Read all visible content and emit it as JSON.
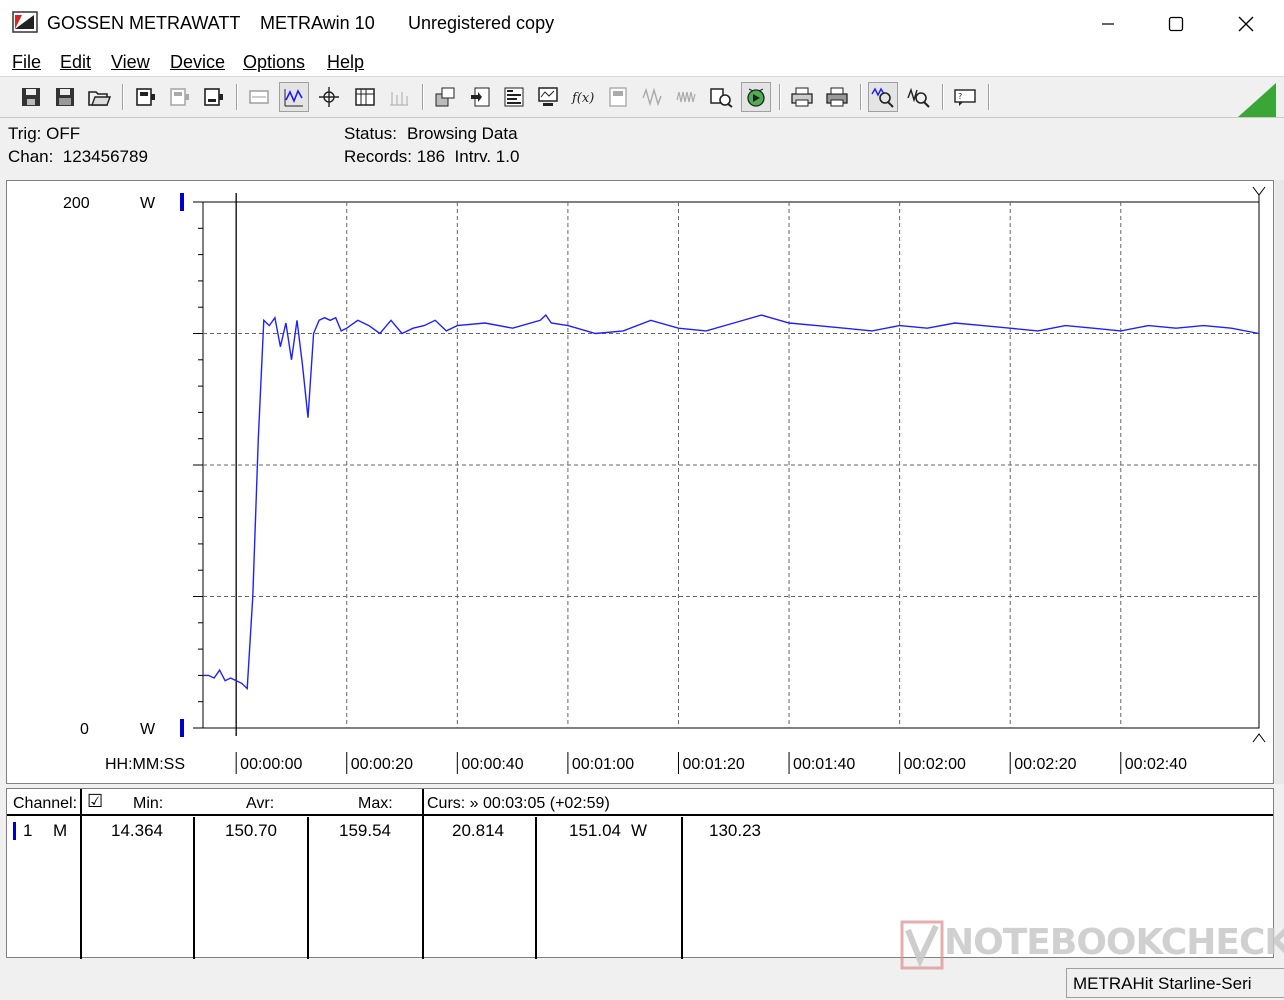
{
  "window": {
    "vendor": "GOSSEN METRAWATT",
    "app": "METRAwin 10",
    "license": "Unregistered copy"
  },
  "menu": [
    "File",
    "Edit",
    "View",
    "Device",
    "Options",
    "Help"
  ],
  "toolbar_icons": [
    "save-icon",
    "save-as-icon",
    "open-icon",
    "device-icon",
    "device-settings-icon",
    "device-read-icon",
    "table-view-icon",
    "chart-view-icon",
    "cursor-icon",
    "list-view-icon",
    "disabled-grid-icon",
    "export-icon",
    "import-icon",
    "statistics-icon",
    "monitor-icon",
    "function-icon",
    "disabled-meter-icon",
    "disabled-wave-icon",
    "disabled-wave2-icon",
    "search-device-icon",
    "trigger-icon",
    "print-preview-icon",
    "print-icon",
    "zoom-in-icon",
    "zoom-out-icon",
    "help-icon"
  ],
  "info": {
    "trig": "Trig: OFF",
    "chan": "Chan:  123456789",
    "status_label": "Status:",
    "status_value": "Browsing Data",
    "records": "Records: 186  Intrv. 1.0"
  },
  "chart_data": {
    "type": "line",
    "y_top_label": "200",
    "y_bottom_label": "0",
    "y_unit": "W",
    "ylim": [
      0,
      200
    ],
    "x_axis_label": "HH:MM:SS",
    "x_ticks": [
      "00:00:00",
      "00:00:20",
      "00:00:40",
      "00:01:00",
      "00:01:20",
      "00:01:40",
      "00:02:00",
      "00:02:20",
      "00:02:40"
    ],
    "x_range_seconds": [
      -6,
      185
    ],
    "cursor_x": 0,
    "grid": true,
    "series": [
      {
        "color": "#2020ff",
        "x": [
          -6,
          -5,
          -4,
          -3,
          -2,
          -1,
          0,
          1,
          2,
          3,
          4,
          5,
          6,
          7,
          8,
          9,
          10,
          11,
          12,
          13,
          14,
          15,
          16,
          17,
          18,
          19,
          20,
          22,
          24,
          26,
          28,
          30,
          32,
          34,
          36,
          38,
          40,
          45,
          50,
          55,
          56,
          57,
          60,
          65,
          70,
          75,
          80,
          85,
          90,
          95,
          100,
          105,
          110,
          115,
          120,
          125,
          130,
          135,
          140,
          145,
          150,
          155,
          160,
          165,
          170,
          175,
          180,
          185
        ],
        "values": [
          20,
          20,
          19,
          22,
          18,
          19,
          18,
          17,
          15,
          50,
          110,
          155,
          153,
          156,
          145,
          154,
          140,
          155,
          138,
          118,
          150,
          155,
          156,
          155,
          156,
          151,
          152,
          155,
          153,
          150,
          155,
          150,
          152,
          153,
          155,
          151,
          153,
          154,
          152,
          155,
          157,
          154,
          153,
          150,
          151,
          155,
          152,
          151,
          154,
          157,
          154,
          153,
          152,
          151,
          153,
          152,
          154,
          153,
          152,
          151,
          153,
          152,
          151,
          153,
          152,
          153,
          152,
          150
        ]
      }
    ]
  },
  "table": {
    "headers": {
      "channel": "Channel:",
      "checkbox": "☑",
      "min": "Min:",
      "avr": "Avr:",
      "max": "Max:",
      "curs": "Curs: » 00:03:05 (+02:59)"
    },
    "row": {
      "num": "1",
      "mode": "M",
      "min": "14.364",
      "avr": "150.70",
      "max": "159.54",
      "curs1": "20.814",
      "curs2": "151.04",
      "unit": "W",
      "curs3": "130.23"
    }
  },
  "status": {
    "device": "METRAHit Starline-Seri"
  },
  "watermark": "NOTEBOOKCHECK",
  "colors": {
    "trace": "#2020ff",
    "marker": "#0000cc",
    "corner": "#3aa636"
  }
}
